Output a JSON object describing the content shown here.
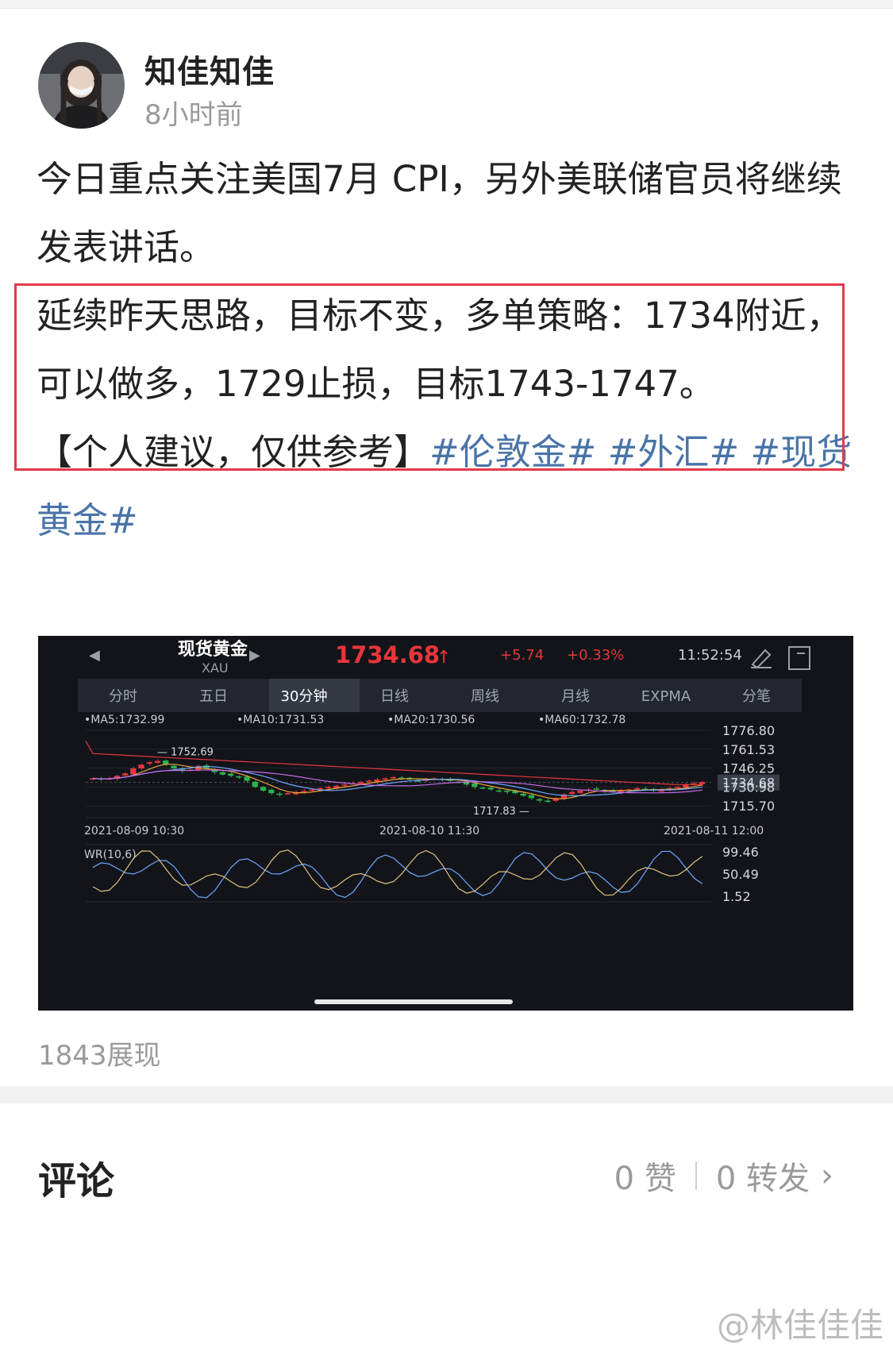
{
  "post": {
    "username": "知佳知佳",
    "time": "8小时前",
    "line1": "今日重点关注美国7月 CPI，另外美联储官员将继续发表讲话。",
    "highlight": "延续昨天思路，目标不变，多单策略：1734附近，可以做多，1729止损，目标1743-1747。",
    "note": "【个人建议，仅供参考】",
    "tags": [
      "#伦敦金#",
      "#外汇#",
      "#现货黄金#"
    ],
    "views": "1843展现"
  },
  "chart_widget": {
    "name": "现货黄金",
    "symbol": "XAU",
    "price": "1734.68",
    "change": "+5.74",
    "change_pct": "+0.33%",
    "clock": "11:52:54",
    "tabs": [
      "分时",
      "五日",
      "30分钟",
      "日线",
      "周线",
      "月线",
      "EXPMA",
      "分笔"
    ],
    "active_tab": "30分钟",
    "ma_labels": [
      "MA5:1732.99",
      "MA10:1731.53",
      "MA20:1730.56",
      "MA60:1732.78"
    ],
    "y_ticks": [
      "1776.80",
      "1761.53",
      "1746.25",
      "1734.68",
      "1730.98",
      "1715.70"
    ],
    "x_ticks": [
      "2021-08-09 10:30",
      "2021-08-10 11:30",
      "2021-08-11 12:00"
    ],
    "high_label": "1752.69",
    "low_label": "1717.83",
    "wr_label": "WR(10,6)",
    "wr_ticks": [
      "99.46",
      "50.49",
      "1.52"
    ],
    "colors": {
      "up": "#e8363a",
      "down": "#2bb34b",
      "bg": "#12141a"
    }
  },
  "comments": {
    "title": "评论",
    "likes": "0 赞",
    "reposts": "0 转发"
  },
  "watermark": "@林佳佳佳"
}
